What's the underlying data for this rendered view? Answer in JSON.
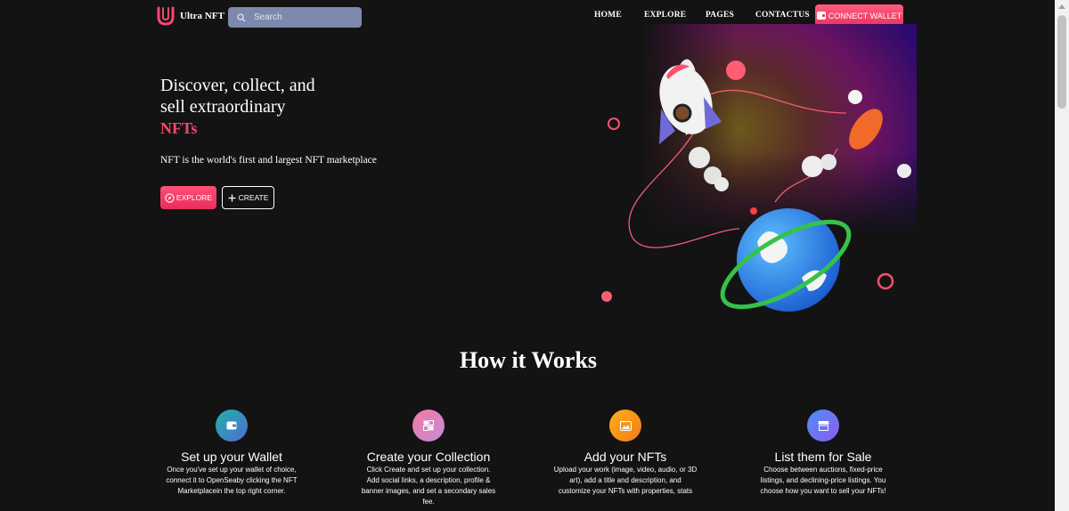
{
  "header": {
    "logo_text": "Ultra NFT",
    "search_placeholder": "Search",
    "nav": [
      "HOME",
      "EXPLORE",
      "PAGES",
      "CONTACTUS"
    ],
    "connect_label": "CONNECT WALLET"
  },
  "hero": {
    "title_line1": "Discover, collect, and",
    "title_line2": "sell extraordinary",
    "title_accent": "NFTs",
    "subtitle": "NFT is the world's first and largest NFT marketplace",
    "explore_label": "EXPLORE",
    "create_label": "CREATE"
  },
  "how": {
    "title": "How it Works",
    "steps": [
      {
        "title": "Set up your Wallet",
        "desc": "Once you've set up your wallet of choice, connect it to OpenSeaby clicking the NFT Marketplacein the top right corner."
      },
      {
        "title": "Create your Collection",
        "desc": "Click Create and set up your collection. Add social links, a description, profile & banner images, and set a secondary sales fee."
      },
      {
        "title": "Add your NFTs",
        "desc": "Upload your work (image, video, audio, or 3D art), add a title and description, and customize your NFTs with properties, stats"
      },
      {
        "title": "List them for Sale",
        "desc": "Choose between auctions, fixed-price listings, and declining-price listings. You choose how you want to sell your NFTs!"
      }
    ]
  },
  "colors": {
    "accent": "#f6476f",
    "background": "#131313",
    "search_bg": "#7d89ac"
  },
  "icons": [
    "logo-icon",
    "search-icon",
    "wallet-icon",
    "compass-icon",
    "plus-icon",
    "collection-icon",
    "image-icon",
    "store-icon"
  ]
}
